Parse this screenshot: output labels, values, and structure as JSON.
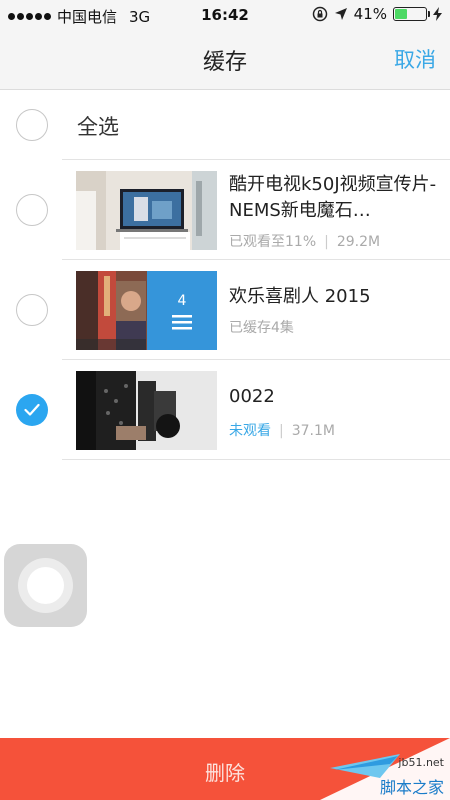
{
  "status_bar": {
    "carrier": "中国电信",
    "network": "3G",
    "time": "16:42",
    "battery": "41%",
    "battery_level": 0.41
  },
  "nav": {
    "title": "缓存",
    "cancel": "取消"
  },
  "select_all": {
    "label": "全选",
    "checked": false
  },
  "items": [
    {
      "title": "酷开电视k50J视频宣传片-NEMS新电魔石…",
      "status": "已观看至11%",
      "size": "29.2M",
      "checked": false
    },
    {
      "title": "欢乐喜剧人 2015",
      "status": "已缓存4集",
      "episode_count": "4",
      "checked": false
    },
    {
      "title": "0022",
      "status": "未观看",
      "size": "37.1M",
      "checked": true
    }
  ],
  "footer": {
    "delete": "删除"
  },
  "watermark": {
    "site": "jb51.net",
    "name": "脚本之家"
  },
  "colors": {
    "accent": "#3aa8e6",
    "delete_bar": "#f5523a",
    "battery": "#4cd964"
  }
}
